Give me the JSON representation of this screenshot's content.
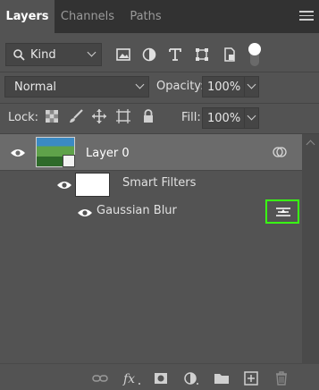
{
  "tabs": [
    {
      "label": "Layers",
      "active": true
    },
    {
      "label": "Channels",
      "active": false
    },
    {
      "label": "Paths",
      "active": false
    }
  ],
  "filter": {
    "kind_label": "Kind",
    "icons": [
      "image-filter-icon",
      "adjustment-filter-icon",
      "type-filter-icon",
      "shape-filter-icon",
      "smart-object-filter-icon"
    ]
  },
  "blend": {
    "mode": "Normal",
    "opacity_label": "Opacity:",
    "opacity_value": "100%"
  },
  "lock": {
    "label": "Lock:",
    "fill_label": "Fill:",
    "fill_value": "100%"
  },
  "layers": [
    {
      "name": "Layer 0",
      "smart_filters_label": "Smart Filters",
      "filters": [
        {
          "name": "Gaussian Blur"
        }
      ]
    }
  ],
  "colors": {
    "panel_bg": "#535353",
    "selected_layer_bg": "#6b6b6b",
    "highlight_outline": "#39ff14"
  }
}
